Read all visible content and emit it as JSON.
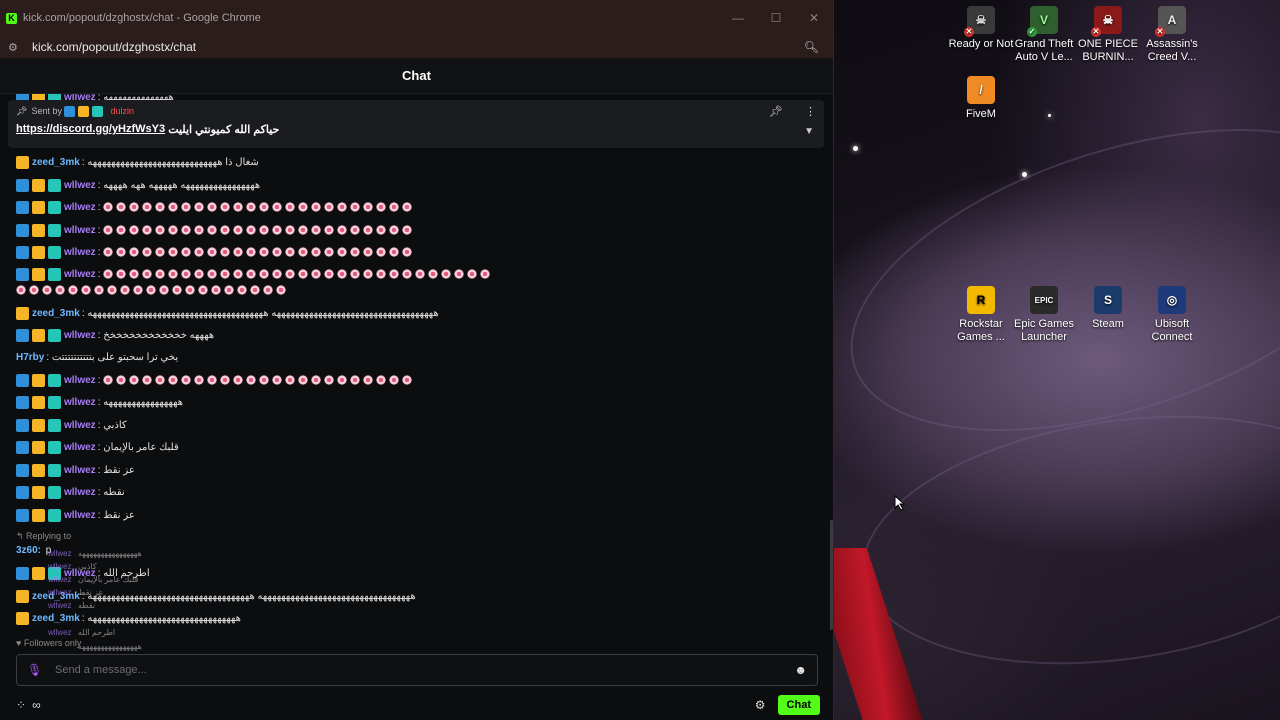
{
  "window": {
    "title": "kick.com/popout/dzghostx/chat - Google Chrome",
    "url": "kick.com/popout/dzghostx/chat",
    "favicon_letter": "K",
    "controls": {
      "minimize": "—",
      "maximize": "☐",
      "close": "✕"
    }
  },
  "chat": {
    "header": "Chat",
    "pinned": {
      "sent_by": "Sent by",
      "sender": "dulzin",
      "text": "حياكم الله كميونتي ايليت",
      "link": "https://discord.gg/yHzfWsY3"
    },
    "top_partial": {
      "user": "wllwez",
      "text": "ههههههههههههههه"
    },
    "messages": [
      {
        "user": "zeed_3mk",
        "text": "شغال ذا ههههههههههههههههههههههههههههه",
        "badges": [
          "crown"
        ],
        "color": "blue"
      },
      {
        "user": "wllwez",
        "text": "ههههههههههههههههه هههههه ههه ههههه",
        "badges": [
          "mod",
          "crown",
          "vip"
        ],
        "color": "purple"
      },
      {
        "user": "wllwez",
        "emotes": 24,
        "badges": [
          "mod",
          "crown",
          "vip"
        ],
        "color": "purple"
      },
      {
        "user": "wllwez",
        "emotes": 24,
        "badges": [
          "mod",
          "crown",
          "vip"
        ],
        "color": "purple"
      },
      {
        "user": "wllwez",
        "emotes": 24,
        "badges": [
          "mod",
          "crown",
          "vip"
        ],
        "color": "purple"
      },
      {
        "user": "wllwez",
        "emotes": 30,
        "emotes_line2": 21,
        "badges": [
          "mod",
          "crown",
          "vip"
        ],
        "color": "purple"
      },
      {
        "user": "zeed_3mk",
        "text": "هههههههههههههههههههههههههههههههههههه ههههههههههههههههههههههههههههههههههههههه",
        "badges": [
          "crown"
        ],
        "color": "blue"
      },
      {
        "user": "wllwez",
        "text": "ههههه خخخخخخخخخخخخخ",
        "badges": [
          "mod",
          "crown",
          "vip"
        ],
        "color": "purple"
      },
      {
        "user": "H7rby",
        "text": "يخي ترا سحبتو على بتتتتتتتتتتت",
        "badges": [],
        "color": "blue"
      },
      {
        "user": "wllwez",
        "emotes": 24,
        "badges": [
          "mod",
          "crown",
          "vip"
        ],
        "color": "purple"
      },
      {
        "user": "wllwez",
        "text": "ههههههههههههههههه",
        "badges": [
          "mod",
          "crown",
          "vip"
        ],
        "color": "purple"
      },
      {
        "user": "wllwez",
        "text": "كاذبي",
        "badges": [
          "mod",
          "crown",
          "vip"
        ],
        "color": "purple"
      },
      {
        "user": "wllwez",
        "text": "قلبك عامر بالإيمان",
        "badges": [
          "mod",
          "crown",
          "vip"
        ],
        "color": "purple"
      },
      {
        "user": "wllwez",
        "text": "عز نقط",
        "badges": [
          "mod",
          "crown",
          "vip"
        ],
        "color": "purple"
      },
      {
        "user": "wllwez",
        "text": "نقطه",
        "badges": [
          "mod",
          "crown",
          "vip"
        ],
        "color": "purple"
      },
      {
        "user": "wllwez",
        "text": "عز نقط",
        "badges": [
          "mod",
          "crown",
          "vip"
        ],
        "color": "purple"
      }
    ],
    "overlap": {
      "replying": "Replying to",
      "user_3z60": "3z60:",
      "user_3z60_text": "p",
      "wllwez_text": "اطرحم الله",
      "zeed1_text": "هههههههههههههههههههههههههههههههههه هههههههههههههههههههههههههههههههههههه",
      "zeed2_text": "ههههههههههههههههههههههههههههههههه",
      "ghost_user": "wllwez",
      "ghost_zeed": "zeed_3mk",
      "ghost_lines": [
        "ههههههههههههههههه",
        "كاذبي",
        "قلبك عامر بالإيمان",
        "عز نقط",
        "نقطه",
        "اطرحم الله",
        "ههههههههههههههههه"
      ]
    },
    "followers_only": "Followers only",
    "input_placeholder": "Send a message...",
    "send_button": "Chat"
  },
  "desktop_icons": [
    {
      "label": "Ready or Not",
      "color": "#3a3a3a",
      "glyph": "☠"
    },
    {
      "label": "Grand Theft Auto V Le...",
      "color": "#2f5f2f",
      "glyph": "V"
    },
    {
      "label": "ONE PIECE BURNIN...",
      "color": "#8a1a1a",
      "glyph": "☠"
    },
    {
      "label": "Assassin's Creed V...",
      "color": "#555555",
      "glyph": "A"
    },
    {
      "label": "FiveM",
      "color": "#f08a24",
      "glyph": "/"
    },
    {
      "label": "Rockstar Games ...",
      "color": "#f5b800",
      "glyph": "R"
    },
    {
      "label": "Epic Games Launcher",
      "color": "#2a2a2a",
      "glyph": "EPIC"
    },
    {
      "label": "Steam",
      "color": "#1b3c6b",
      "glyph": "S"
    },
    {
      "label": "Ubisoft Connect",
      "color": "#1d3a7a",
      "glyph": "◎"
    }
  ],
  "colors": {
    "kick_green": "#53fc18",
    "username_purple": "#a77cf7",
    "username_blue": "#70b8ff",
    "titlebar": "#2a1d1c"
  }
}
